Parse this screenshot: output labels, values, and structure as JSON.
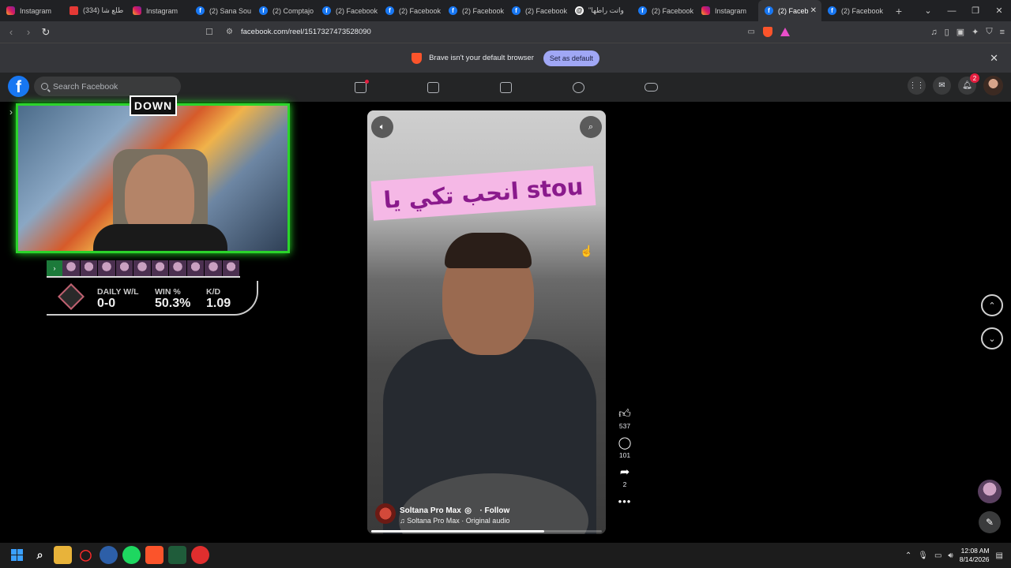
{
  "browser": {
    "tabs": [
      {
        "label": "Instagram",
        "favicon": "instagram"
      },
      {
        "label": "(334) طلع شا",
        "favicon": "youtube"
      },
      {
        "label": "Instagram",
        "favicon": "instagram"
      },
      {
        "label": "(2) Sana Sou",
        "favicon": "facebook"
      },
      {
        "label": "(2) Comptajo",
        "favicon": "facebook"
      },
      {
        "label": "(2) Facebook",
        "favicon": "facebook"
      },
      {
        "label": "(2) Facebook",
        "favicon": "facebook"
      },
      {
        "label": "(2) Facebook",
        "favicon": "facebook"
      },
      {
        "label": "(2) Facebook",
        "favicon": "facebook"
      },
      {
        "label": "\"واتت راطها",
        "favicon": "threads"
      },
      {
        "label": "(2) Facebook",
        "favicon": "facebook"
      },
      {
        "label": "Instagram",
        "favicon": "instagram"
      },
      {
        "label": "(2) Faceb",
        "favicon": "facebook",
        "active": true
      },
      {
        "label": "(2) Facebook",
        "favicon": "facebook"
      }
    ],
    "url": "facebook.com/reel/1517327473528090",
    "infobar": {
      "message": "Brave isn't your default browser",
      "button": "Set as default"
    }
  },
  "facebook": {
    "logo": "f",
    "search_placeholder": "Search Facebook",
    "notifications_count": "2"
  },
  "stream_overlay": {
    "logo_text": "DOWN",
    "stats": [
      {
        "label": "DAILY W/L",
        "value": "0-0"
      },
      {
        "label": "WIN %",
        "value": "50.3%"
      },
      {
        "label": "K/D",
        "value": "1.09"
      }
    ]
  },
  "reel": {
    "caption": "انحب تكي يا stou",
    "owner": "Soltana Pro Max",
    "follow": "· Follow",
    "audio": "Soltana Pro Max · Original audio",
    "progress": 0.75,
    "likes": "537",
    "comments": "101",
    "shares": "2"
  },
  "taskbar": {
    "time": "12:08 AM",
    "date": "8/14/2026"
  },
  "colors": {
    "facebook_blue": "#1877f2",
    "overlay_green": "#2bd42b",
    "caption_bg": "#f5b8e6",
    "caption_text": "#8a1a8c"
  }
}
